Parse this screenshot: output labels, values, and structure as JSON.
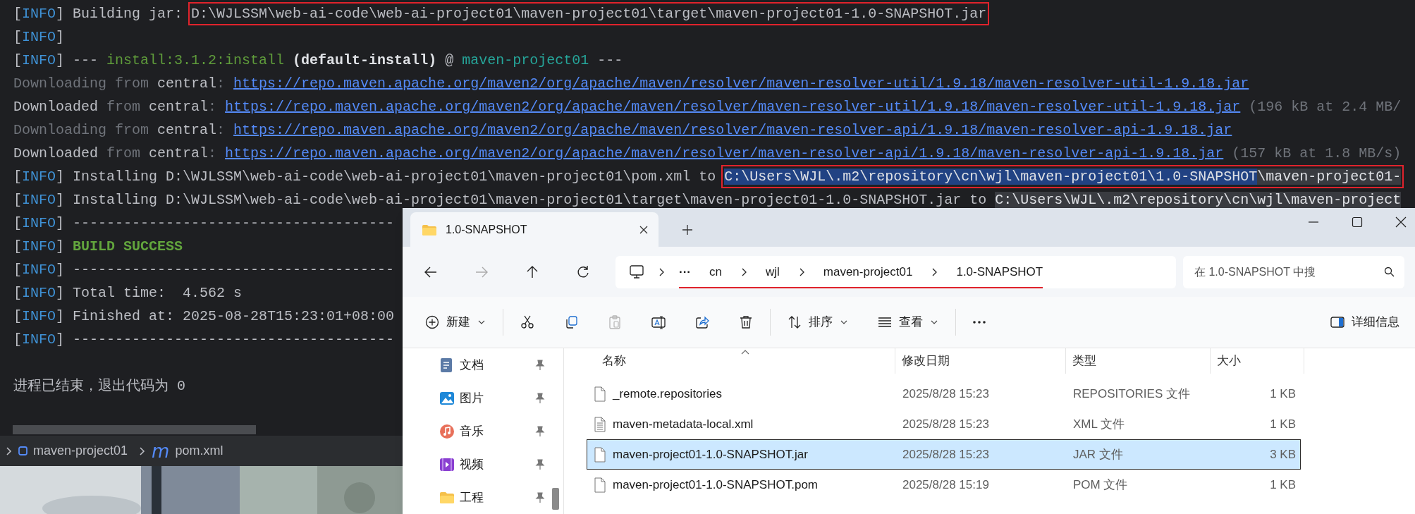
{
  "terminal": {
    "lines": [
      {
        "segments": [
          {
            "kind": "bracket",
            "text": "["
          },
          {
            "kind": "info",
            "text": "INFO"
          },
          {
            "kind": "bracket",
            "text": "] Building jar: "
          },
          {
            "kind": "box",
            "parts": [
              {
                "kind": "text",
                "text": "D:\\WJLSSM\\web-ai-code\\web-ai-project01\\maven-project01\\target\\maven-project01-1.0-SNAPSHOT.jar"
              }
            ]
          }
        ]
      },
      {
        "segments": [
          {
            "kind": "bracket",
            "text": "["
          },
          {
            "kind": "info",
            "text": "INFO"
          },
          {
            "kind": "bracket",
            "text": "]"
          }
        ]
      },
      {
        "segments": [
          {
            "kind": "bracket",
            "text": "["
          },
          {
            "kind": "info",
            "text": "INFO"
          },
          {
            "kind": "bracket",
            "text": "] --- "
          },
          {
            "kind": "goal",
            "text": "install:3.1.2:install"
          },
          {
            "kind": "bold",
            "text": " (default-install)"
          },
          {
            "kind": "text",
            "text": " @ "
          },
          {
            "kind": "project",
            "text": "maven-project01"
          },
          {
            "kind": "text",
            "text": " ---"
          }
        ]
      },
      {
        "segments": [
          {
            "kind": "muted",
            "text": "Downloading from "
          },
          {
            "kind": "text",
            "text": "central"
          },
          {
            "kind": "muted",
            "text": ": "
          },
          {
            "kind": "link",
            "text": "https://repo.maven.apache.org/maven2/org/apache/maven/resolver/maven-resolver-util/1.9.18/maven-resolver-util-1.9.18.jar"
          }
        ]
      },
      {
        "segments": [
          {
            "kind": "text",
            "text": "Downloaded "
          },
          {
            "kind": "muted",
            "text": "from "
          },
          {
            "kind": "text",
            "text": "central"
          },
          {
            "kind": "muted",
            "text": ": "
          },
          {
            "kind": "link",
            "text": "https://repo.maven.apache.org/maven2/org/apache/maven/resolver/maven-resolver-util/1.9.18/maven-resolver-util-1.9.18.jar"
          },
          {
            "kind": "muted",
            "text": " (196 kB at 2.4 MB/"
          }
        ]
      },
      {
        "segments": [
          {
            "kind": "muted",
            "text": "Downloading from "
          },
          {
            "kind": "text",
            "text": "central"
          },
          {
            "kind": "muted",
            "text": ": "
          },
          {
            "kind": "link",
            "text": "https://repo.maven.apache.org/maven2/org/apache/maven/resolver/maven-resolver-api/1.9.18/maven-resolver-api-1.9.18.jar"
          }
        ]
      },
      {
        "segments": [
          {
            "kind": "text",
            "text": "Downloaded "
          },
          {
            "kind": "muted",
            "text": "from "
          },
          {
            "kind": "text",
            "text": "central"
          },
          {
            "kind": "muted",
            "text": ": "
          },
          {
            "kind": "link",
            "text": "https://repo.maven.apache.org/maven2/org/apache/maven/resolver/maven-resolver-api/1.9.18/maven-resolver-api-1.9.18.jar"
          },
          {
            "kind": "muted",
            "text": " (157 kB at 1.8 MB/s)"
          }
        ]
      },
      {
        "segments": [
          {
            "kind": "bracket",
            "text": "["
          },
          {
            "kind": "info",
            "text": "INFO"
          },
          {
            "kind": "bracket",
            "text": "] Installing D:\\WJLSSM\\web-ai-code\\web-ai-project01\\maven-project01\\pom.xml to "
          },
          {
            "kind": "box",
            "parts": [
              {
                "kind": "selection",
                "text": "C:\\Users\\WJL\\.m2\\repository\\cn\\wjl\\maven-project01\\1.0-SNAPSHOT"
              },
              {
                "kind": "match",
                "text": "\\maven-project01-"
              }
            ]
          }
        ]
      },
      {
        "segments": [
          {
            "kind": "bracket",
            "text": "["
          },
          {
            "kind": "info",
            "text": "INFO"
          },
          {
            "kind": "bracket",
            "text": "] Installing D:\\WJLSSM\\web-ai-code\\web-ai-project01\\maven-project01\\target\\maven-project01-1.0-SNAPSHOT.jar to "
          },
          {
            "kind": "match",
            "text": "C:\\Users\\WJL\\.m2\\repository\\cn\\wjl\\maven-project"
          }
        ]
      },
      {
        "segments": [
          {
            "kind": "bracket",
            "text": "["
          },
          {
            "kind": "info",
            "text": "INFO"
          },
          {
            "kind": "bracket",
            "text": "] --------------------------------------"
          }
        ]
      },
      {
        "segments": [
          {
            "kind": "bracket",
            "text": "["
          },
          {
            "kind": "info",
            "text": "INFO"
          },
          {
            "kind": "bracket",
            "text": "] "
          },
          {
            "kind": "success",
            "text": "BUILD SUCCESS"
          }
        ]
      },
      {
        "segments": [
          {
            "kind": "bracket",
            "text": "["
          },
          {
            "kind": "info",
            "text": "INFO"
          },
          {
            "kind": "bracket",
            "text": "] --------------------------------------"
          }
        ]
      },
      {
        "segments": [
          {
            "kind": "bracket",
            "text": "["
          },
          {
            "kind": "info",
            "text": "INFO"
          },
          {
            "kind": "bracket",
            "text": "] Total time:  4.562 s"
          }
        ]
      },
      {
        "segments": [
          {
            "kind": "bracket",
            "text": "["
          },
          {
            "kind": "info",
            "text": "INFO"
          },
          {
            "kind": "bracket",
            "text": "] Finished at: 2025-08-28T15:23:01+08:00"
          }
        ]
      },
      {
        "segments": [
          {
            "kind": "bracket",
            "text": "["
          },
          {
            "kind": "info",
            "text": "INFO"
          },
          {
            "kind": "bracket",
            "text": "] --------------------------------------"
          }
        ]
      }
    ],
    "exit_message": "进程已结束，退出代码为 0"
  },
  "ide_breadcrumbs": [
    {
      "kind": "module",
      "label": "maven-project01"
    },
    {
      "kind": "maven",
      "icon_text": "m",
      "label": "pom.xml"
    }
  ],
  "explorer": {
    "tabs": [
      {
        "title": "1.0-SNAPSHOT",
        "selected": true
      }
    ],
    "address": {
      "overflow": "···",
      "crumbs": [
        "cn",
        "wjl",
        "maven-project01",
        "1.0-SNAPSHOT"
      ],
      "underlined": true
    },
    "search": {
      "placeholder": "在 1.0-SNAPSHOT 中搜"
    },
    "toolbar": {
      "groups": [
        [
          {
            "kind": "new",
            "label": "新建",
            "dropdown": true,
            "disabled": false
          }
        ],
        [
          {
            "kind": "cut",
            "disabled": false
          },
          {
            "kind": "copy",
            "disabled": false
          },
          {
            "kind": "paste",
            "disabled": true
          },
          {
            "kind": "rename",
            "disabled": false
          },
          {
            "kind": "share",
            "disabled": false
          },
          {
            "kind": "delete",
            "disabled": false
          }
        ],
        [
          {
            "kind": "sort",
            "label": "排序",
            "dropdown": true,
            "disabled": false
          },
          {
            "kind": "view",
            "label": "查看",
            "dropdown": true,
            "disabled": false
          }
        ],
        [
          {
            "kind": "more",
            "disabled": false
          }
        ]
      ],
      "details": {
        "label": "详细信息"
      }
    },
    "sidebar": [
      {
        "kind": "documents",
        "label": "文档",
        "pinned": true
      },
      {
        "kind": "pictures",
        "label": "图片",
        "pinned": true
      },
      {
        "kind": "music",
        "label": "音乐",
        "pinned": true
      },
      {
        "kind": "videos",
        "label": "视频",
        "pinned": true
      },
      {
        "kind": "folder",
        "label": "工程",
        "pinned": true
      }
    ],
    "columns": [
      {
        "label": "名称",
        "sorted": true
      },
      {
        "label": "修改日期",
        "sorted": false
      },
      {
        "label": "类型",
        "sorted": false
      },
      {
        "label": "大小",
        "sorted": false
      }
    ],
    "rows": [
      {
        "kind": "file",
        "name": "_remote.repositories",
        "date": "2025/8/28 15:23",
        "type": "REPOSITORIES 文件",
        "size": "1 KB",
        "selected": false
      },
      {
        "kind": "text-file",
        "name": "maven-metadata-local.xml",
        "date": "2025/8/28 15:23",
        "type": "XML 文件",
        "size": "1 KB",
        "selected": false
      },
      {
        "kind": "file",
        "name": "maven-project01-1.0-SNAPSHOT.jar",
        "date": "2025/8/28 15:23",
        "type": "JAR 文件",
        "size": "3 KB",
        "selected": true
      },
      {
        "kind": "file",
        "name": "maven-project01-1.0-SNAPSHOT.pom",
        "date": "2025/8/28 15:19",
        "type": "POM 文件",
        "size": "1 KB",
        "selected": false
      }
    ]
  }
}
